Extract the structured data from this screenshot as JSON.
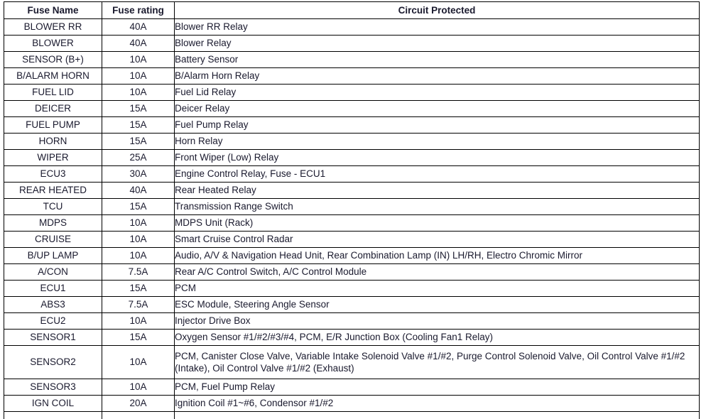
{
  "table": {
    "columns": [
      {
        "key": "fuse_name",
        "label": "Fuse Name",
        "align": "center"
      },
      {
        "key": "fuse_rating",
        "label": "Fuse rating",
        "align": "center"
      },
      {
        "key": "circuit_protected",
        "label": "Circuit Protected",
        "align": "center"
      }
    ],
    "rows": [
      {
        "fuse_name": "BLOWER RR",
        "fuse_rating": "40A",
        "circuit_protected": "Blower RR Relay"
      },
      {
        "fuse_name": "BLOWER",
        "fuse_rating": "40A",
        "circuit_protected": "Blower Relay"
      },
      {
        "fuse_name": "SENSOR (B+)",
        "fuse_rating": "10A",
        "circuit_protected": "Battery Sensor"
      },
      {
        "fuse_name": "B/ALARM HORN",
        "fuse_rating": "10A",
        "circuit_protected": "B/Alarm Horn Relay"
      },
      {
        "fuse_name": "FUEL LID",
        "fuse_rating": "10A",
        "circuit_protected": "Fuel Lid Relay"
      },
      {
        "fuse_name": "DEICER",
        "fuse_rating": "15A",
        "circuit_protected": "Deicer Relay"
      },
      {
        "fuse_name": "FUEL PUMP",
        "fuse_rating": "15A",
        "circuit_protected": "Fuel Pump Relay"
      },
      {
        "fuse_name": "HORN",
        "fuse_rating": "15A",
        "circuit_protected": "Horn Relay"
      },
      {
        "fuse_name": "WIPER",
        "fuse_rating": "25A",
        "circuit_protected": "Front Wiper (Low) Relay"
      },
      {
        "fuse_name": "ECU3",
        "fuse_rating": "30A",
        "circuit_protected": "Engine Control Relay, Fuse - ECU1"
      },
      {
        "fuse_name": "REAR HEATED",
        "fuse_rating": "40A",
        "circuit_protected": "Rear Heated Relay"
      },
      {
        "fuse_name": "TCU",
        "fuse_rating": "15A",
        "circuit_protected": "Transmission Range Switch"
      },
      {
        "fuse_name": "MDPS",
        "fuse_rating": "10A",
        "circuit_protected": "MDPS Unit (Rack)"
      },
      {
        "fuse_name": "CRUISE",
        "fuse_rating": "10A",
        "circuit_protected": "Smart Cruise Control Radar"
      },
      {
        "fuse_name": "B/UP LAMP",
        "fuse_rating": "10A",
        "circuit_protected": "Audio, A/V & Navigation Head Unit, Rear Combination Lamp (IN) LH/RH, Electro Chromic Mirror"
      },
      {
        "fuse_name": "A/CON",
        "fuse_rating": "7.5A",
        "circuit_protected": "Rear A/C Control Switch, A/C Control Module"
      },
      {
        "fuse_name": "ECU1",
        "fuse_rating": "15A",
        "circuit_protected": "PCM"
      },
      {
        "fuse_name": "ABS3",
        "fuse_rating": "7.5A",
        "circuit_protected": "ESC Module, Steering Angle Sensor"
      },
      {
        "fuse_name": "ECU2",
        "fuse_rating": "10A",
        "circuit_protected": "Injector Drive Box"
      },
      {
        "fuse_name": "SENSOR1",
        "fuse_rating": "15A",
        "circuit_protected": "Oxygen Sensor #1/#2/#3/#4, PCM, E/R Junction Box (Cooling Fan1 Relay)"
      },
      {
        "fuse_name": "SENSOR2",
        "fuse_rating": "10A",
        "circuit_protected": "PCM, Canister Close Valve, Variable Intake Solenoid Valve #1/#2, Purge Control Solenoid Valve, Oil Control Valve #1/#2 (Intake), Oil Control Valve #1/#2 (Exhaust)",
        "tall": true
      },
      {
        "fuse_name": "SENSOR3",
        "fuse_rating": "10A",
        "circuit_protected": "PCM, Fuel Pump Relay"
      },
      {
        "fuse_name": "IGN COIL",
        "fuse_rating": "20A",
        "circuit_protected": "Ignition Coil #1~#6, Condensor #1/#2"
      },
      {
        "fuse_name": "",
        "fuse_rating": "",
        "circuit_protected": "",
        "partial": true
      }
    ]
  },
  "style": {
    "border_color": "#000000",
    "text_color": "#1a1a2e",
    "background": "#ffffff"
  }
}
